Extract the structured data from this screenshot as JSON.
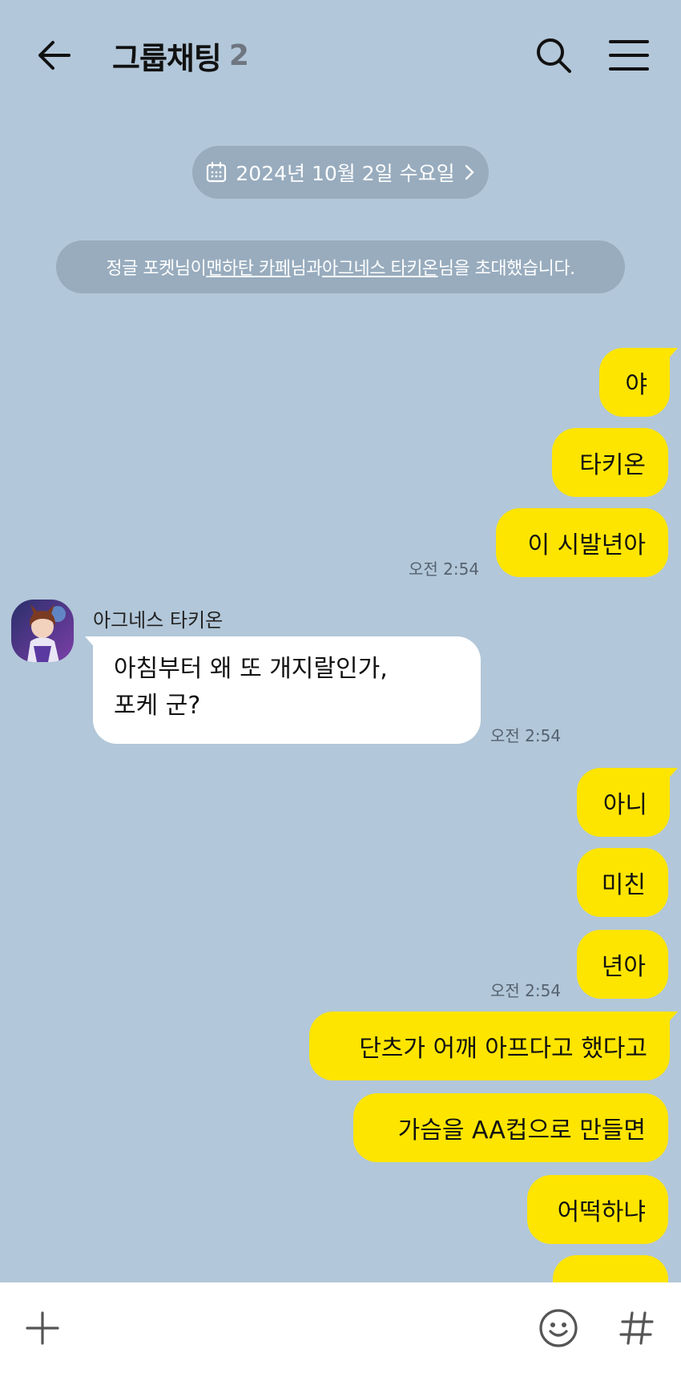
{
  "header": {
    "title": "그룹채팅",
    "member_count": "2"
  },
  "date_divider": {
    "label": "2024년 10월 2일 수요일"
  },
  "system_notice": {
    "inviter": "정글 포켓님이 ",
    "invitee_1": "맨하탄 카페",
    "between": "님과 ",
    "invitee_2": "아그네스 타키온",
    "suffix": "님을 초대했습니다."
  },
  "messages": [
    {
      "from": "me",
      "text": "야"
    },
    {
      "from": "me",
      "text": "타키온"
    },
    {
      "from": "me",
      "text": "이 시발년아",
      "time": "오전 2:54"
    },
    {
      "from": "other",
      "sender": "아그네스 타키온",
      "lines": [
        "아침부터 왜 또 개지랄인가,",
        "포케 군?"
      ],
      "time": "오전 2:54"
    },
    {
      "from": "me",
      "text": "아니"
    },
    {
      "from": "me",
      "text": "미친"
    },
    {
      "from": "me",
      "text": "년아",
      "time": "오전 2:54"
    },
    {
      "from": "me",
      "text": "단츠가 어깨 아프다고 했다고"
    },
    {
      "from": "me",
      "text": "가슴을 AA컵으로 만들면"
    },
    {
      "from": "me",
      "text": "어떡하냐"
    }
  ],
  "colors": {
    "background": "#b2c7d9",
    "my_bubble": "#fee500",
    "their_bubble": "#ffffff"
  },
  "icons": [
    "back-arrow-icon",
    "search-icon",
    "hamburger-menu-icon",
    "calendar-icon",
    "chevron-right-icon",
    "plus-icon",
    "emoji-icon",
    "hashtag-icon"
  ]
}
